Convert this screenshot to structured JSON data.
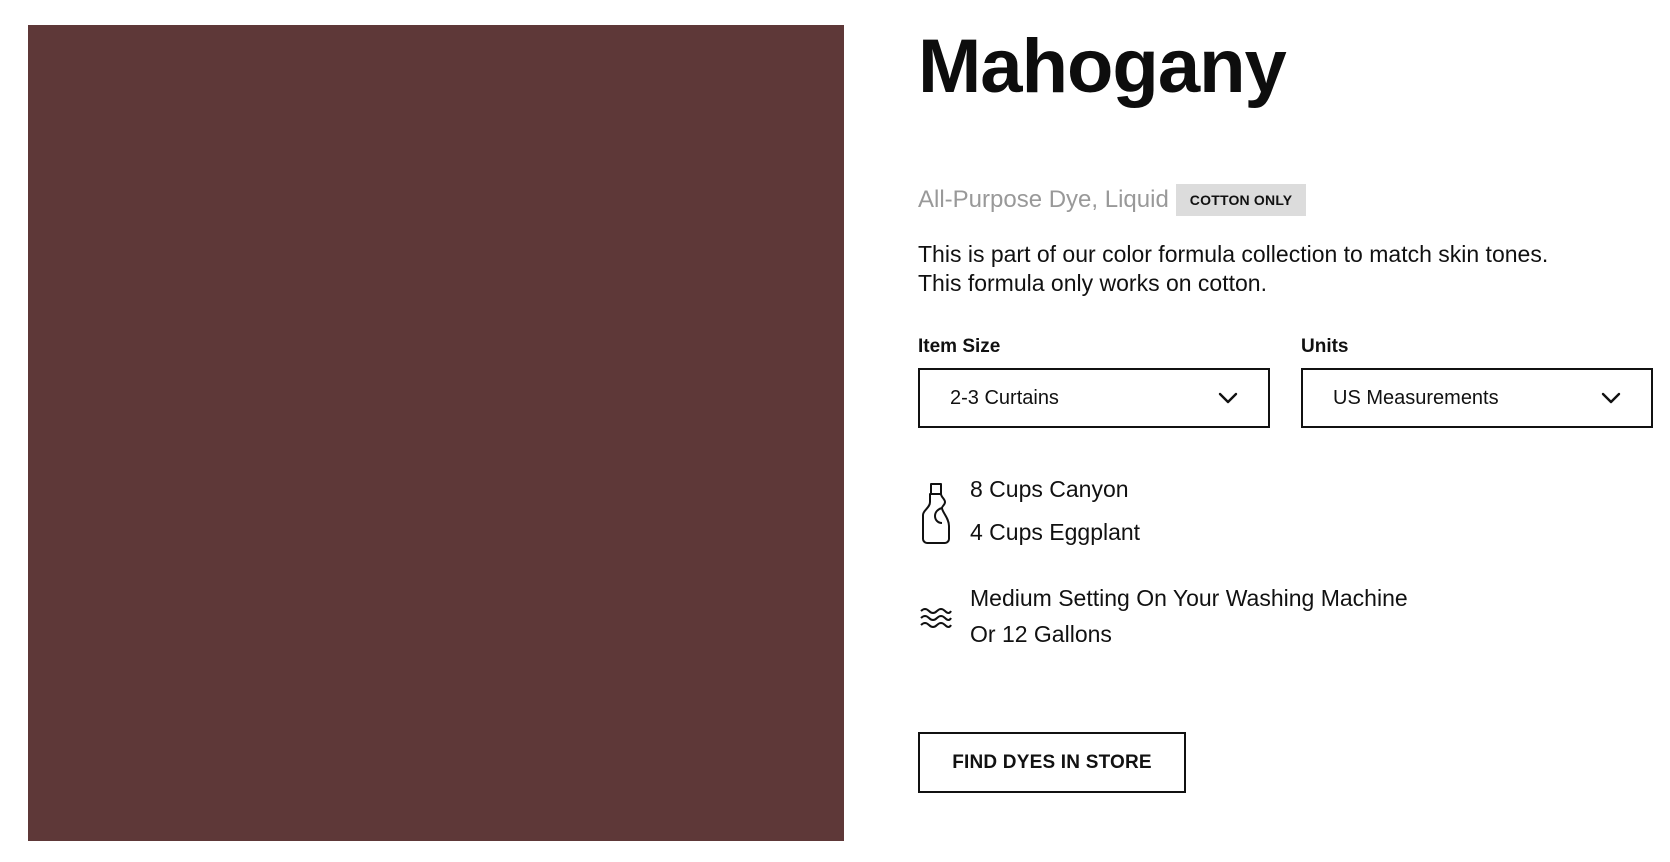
{
  "product": {
    "name": "Mahogany",
    "swatch_color": "#5e3838",
    "type": "All-Purpose Dye, Liquid",
    "badge": "COTTON ONLY",
    "description_lines": [
      "This is part of our color formula collection to match skin tones.",
      "This formula only works on cotton."
    ]
  },
  "item_size": {
    "label": "Item Size",
    "selected": "2-3 Curtains",
    "icon": "chevron-down-icon"
  },
  "units": {
    "label": "Units",
    "selected": "US Measurements",
    "icon": "chevron-down-icon"
  },
  "recipe": {
    "dye_icon": "dye-bottle-icon",
    "dyes": [
      "8 Cups Canyon",
      "4 Cups Eggplant"
    ],
    "water_icon": "water-waves-icon",
    "water": [
      "Medium Setting On Your Washing Machine",
      "Or 12 Gallons"
    ]
  },
  "cta": {
    "label": "FIND DYES IN STORE"
  }
}
